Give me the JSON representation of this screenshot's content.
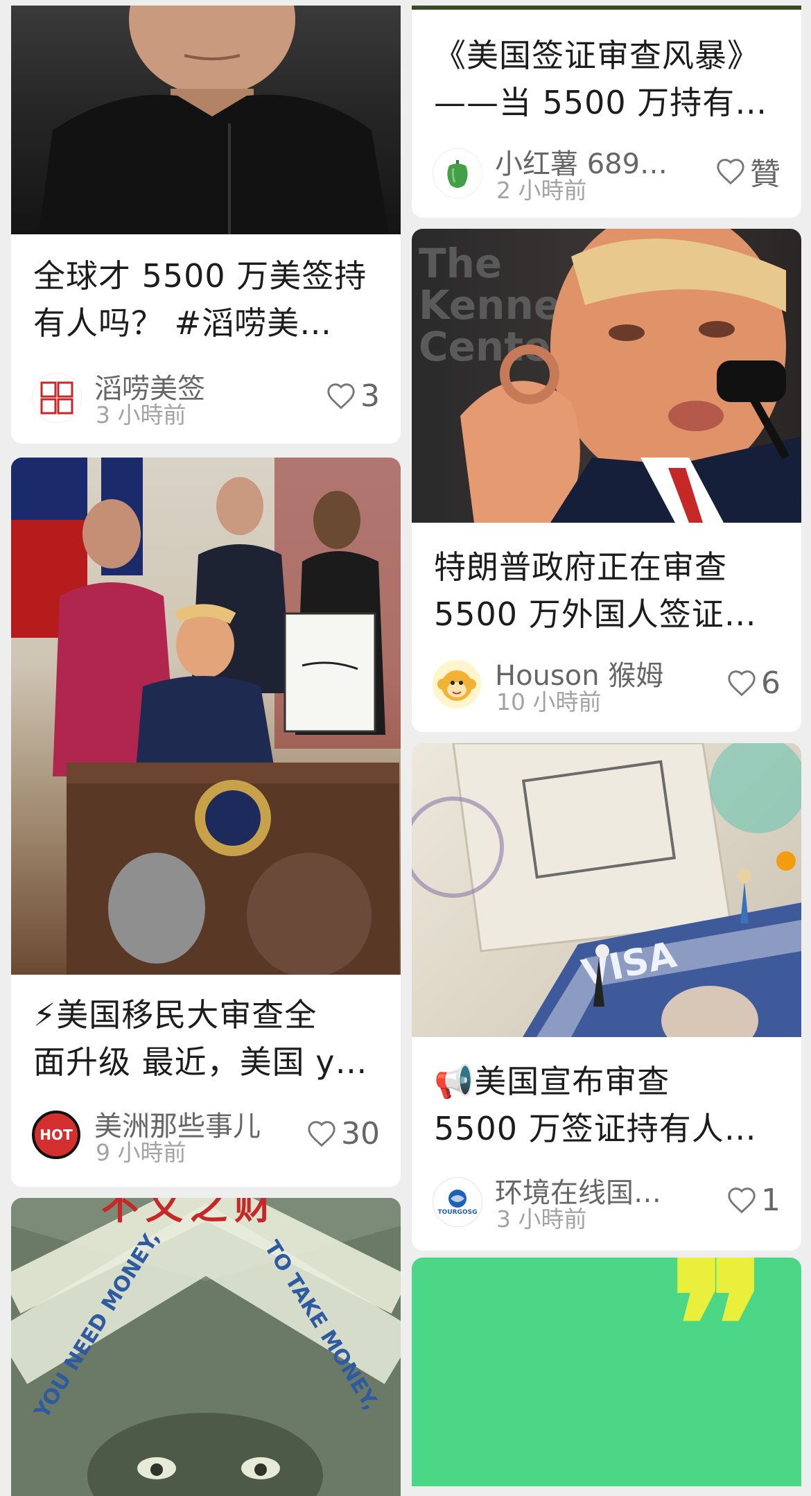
{
  "cards": [
    {
      "title": [
        "全球才 5500 万美签持",
        "有人吗？ #滔唠美…"
      ],
      "author": "滔唠美签",
      "time": "3 小時前",
      "likes": "3"
    },
    {
      "title": [
        "⚡美国移民大审查全",
        "面升级 最近，美国 y…"
      ],
      "author": "美洲那些事儿",
      "time": "9 小時前",
      "likes": "30",
      "avatar_text": "HOT"
    },
    {
      "image_text": "不义之财",
      "note_left": "YOU NEED MONEY,",
      "note_right": "TO TAKE MONEY,"
    },
    {
      "title": [
        "《美国签证审查风暴》",
        "——当 5500 万持有…"
      ],
      "author": "小红薯 689…",
      "time": "2 小時前",
      "likes": "贊"
    },
    {
      "title": [
        "特朗普政府正在审查",
        "5500 万外国人签证…"
      ],
      "author": "Houson 猴姆",
      "time": "10 小時前",
      "likes": "6",
      "image_text": [
        "The",
        "Kennedy",
        "Center"
      ]
    },
    {
      "title": [
        "📢美国宣布审查",
        "5500 万签证持有人…"
      ],
      "author": "环境在线国…",
      "time": "3 小時前",
      "likes": "1",
      "avatar_text": "TOURGOSG",
      "image_text": "VISA"
    },
    {
      "quote_glyph": "❞"
    }
  ]
}
